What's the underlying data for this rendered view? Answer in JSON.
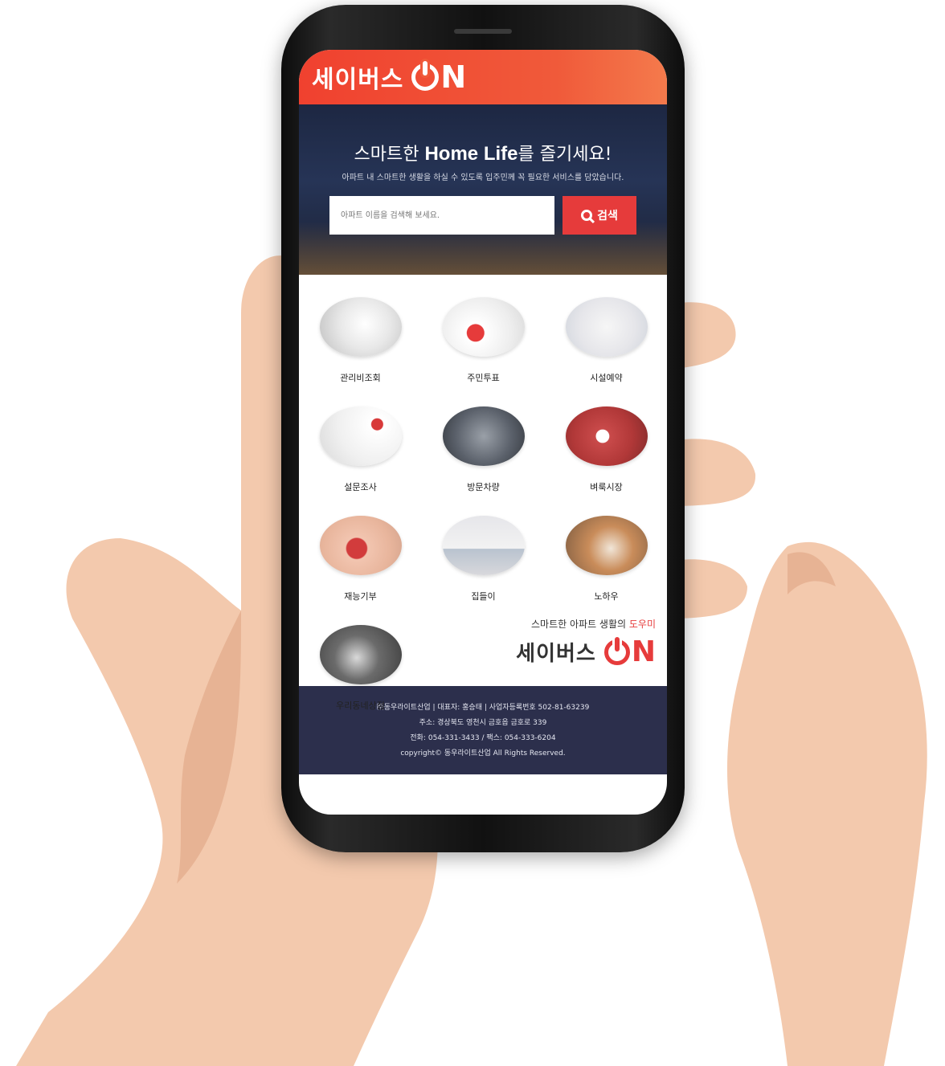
{
  "header": {
    "logo_text": "세이버스",
    "logo_on": "N"
  },
  "hero": {
    "title_prefix": "스마트한 ",
    "title_bold": "Home Life",
    "title_suffix": "를 즐기세요!",
    "subtitle": "아파트 내 스마트한 생활을 하실 수 있도록 입주민께 꼭 필요한 서비스를 담았습니다."
  },
  "search": {
    "placeholder": "아파트 이름을 검색해 보세요.",
    "button_label": "검색"
  },
  "menu": [
    {
      "label": "관리비조회",
      "icon": "calculator-icon"
    },
    {
      "label": "주민투표",
      "icon": "vote-stamp-icon"
    },
    {
      "label": "시설예약",
      "icon": "calendar-icon"
    },
    {
      "label": "설문조사",
      "icon": "checklist-icon"
    },
    {
      "label": "방문차량",
      "icon": "car-icon"
    },
    {
      "label": "벼룩시장",
      "icon": "gift-icon"
    },
    {
      "label": "재능기부",
      "icon": "heart-hands-icon"
    },
    {
      "label": "집들이",
      "icon": "interior-icon"
    },
    {
      "label": "노하우",
      "icon": "knowhow-icon"
    },
    {
      "label": "우리동네상점",
      "icon": "open-sign-icon"
    }
  ],
  "promo": {
    "tagline_prefix": "스마트한 아파트 생활의 ",
    "tagline_highlight": "도우미",
    "logo_text": "세이버스",
    "logo_on": "N"
  },
  "footer": {
    "line1": "㈜동우라이트산업 | 대표자: 홍승태 | 사업자등록번호 502-81-63239",
    "line2": "주소: 경상북도 영천시 금호읍 금호로 339",
    "line3": "전화: 054-331-3433 / 팩스: 054-333-6204",
    "line4": "copyright© 동우라이트산업 All Rights Reserved."
  },
  "colors": {
    "brand_red": "#e63b3b",
    "header_gradient_start": "#f0412f",
    "footer_bg": "#2c2f4c"
  }
}
